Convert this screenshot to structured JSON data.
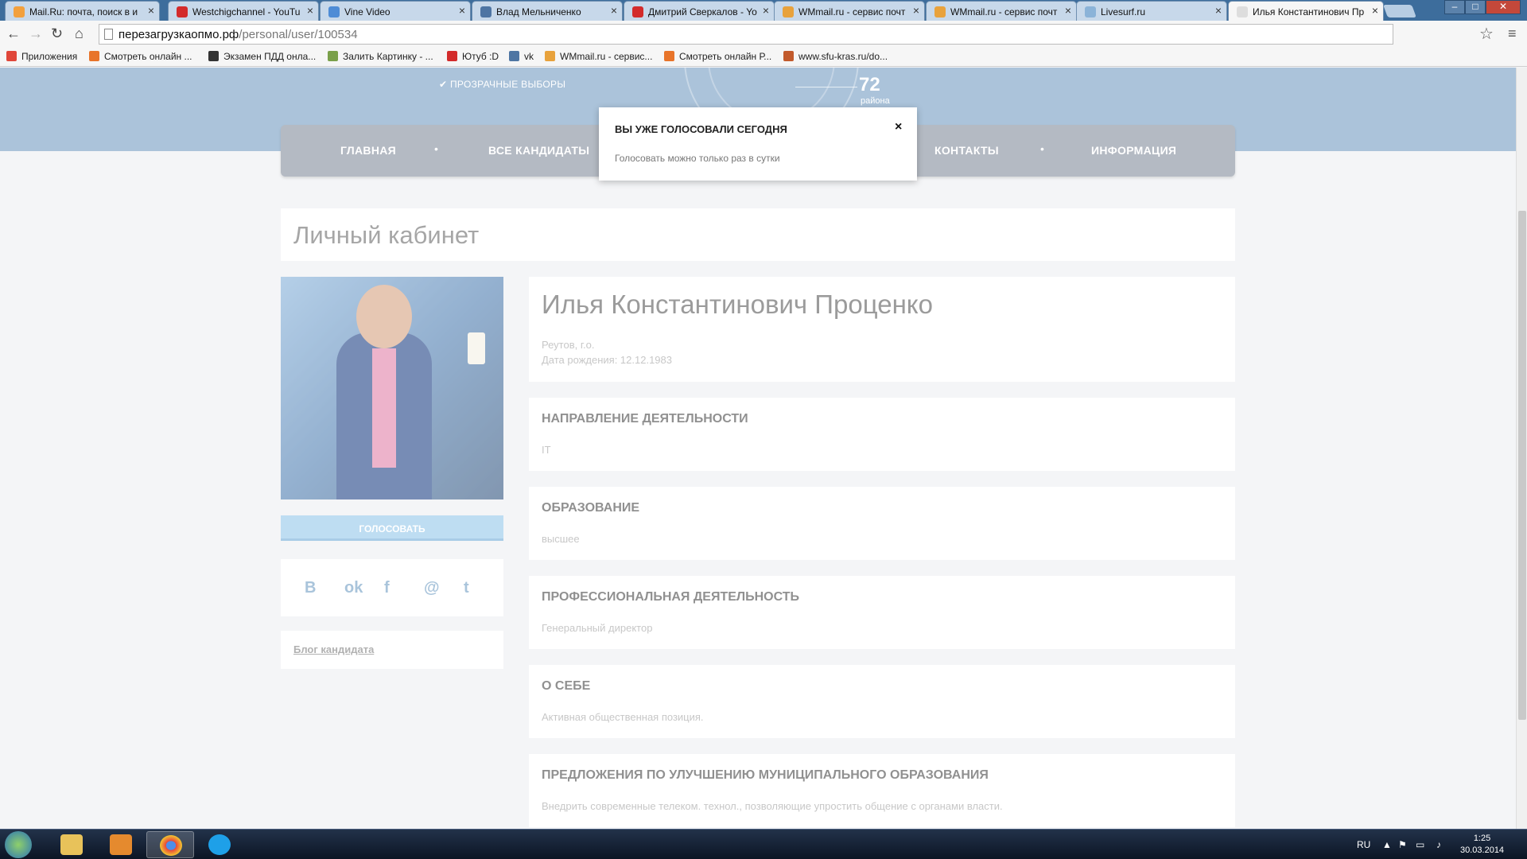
{
  "browser": {
    "tabs": [
      {
        "label": "Mail.Ru: почта, поиск в и",
        "icon": "mailru-icon",
        "color": "#f2a03d"
      },
      {
        "label": "Westchigchannel - YouTu",
        "icon": "youtube-icon",
        "color": "#d32b2b"
      },
      {
        "label": "Vine Video",
        "icon": "vine-icon",
        "color": "#4e8cd6"
      },
      {
        "label": "Влад Мельниченко",
        "icon": "vk-icon",
        "color": "#4e75a3"
      },
      {
        "label": "Дмитрий Сверкалов - Yo",
        "icon": "youtube-icon",
        "color": "#d32b2b"
      },
      {
        "label": "WMmail.ru - сервис почт",
        "icon": "wmmail-icon",
        "color": "#e8a23c"
      },
      {
        "label": "WMmail.ru - сервис почт",
        "icon": "wmmail-icon",
        "color": "#e8a23c"
      },
      {
        "label": "Livesurf.ru",
        "icon": "livesurf-icon",
        "color": "#8bb3d8"
      },
      {
        "label": "Илья Константинович Пр",
        "icon": "page-icon",
        "color": "#dddddd"
      }
    ],
    "url_host": "перезагрузкаопмо.рф",
    "url_path": "/personal/user/100534",
    "bookmarks": [
      {
        "label": "Приложения",
        "icon": "apps-icon",
        "color": "#e0473a"
      },
      {
        "label": "Смотреть онлайн ...",
        "icon": "f-icon",
        "color": "#e8742a"
      },
      {
        "label": "Экзамен ПДД онла...",
        "icon": "car-icon",
        "color": "#333333"
      },
      {
        "label": "Залить Картинку - ...",
        "icon": "image-icon",
        "color": "#7aa04a"
      },
      {
        "label": "Ютуб :D",
        "icon": "youtube-icon",
        "color": "#d32b2b"
      },
      {
        "label": "vk",
        "icon": "vk-icon",
        "color": "#4e75a3"
      },
      {
        "label": "WMmail.ru - сервис...",
        "icon": "wmmail-icon",
        "color": "#e8a23c"
      },
      {
        "label": "Смотреть онлайн Р...",
        "icon": "f-icon",
        "color": "#e8742a"
      },
      {
        "label": "www.sfu-kras.ru/do...",
        "icon": "sfu-icon",
        "color": "#c25a2c"
      }
    ]
  },
  "hero": {
    "fair": "ПРОЗРАЧНЫЕ ВЫБОРЫ",
    "count": "72",
    "count_label": "района"
  },
  "nav": [
    "ГЛАВНАЯ",
    "ВСЕ КАНДИДАТЫ",
    "КОНТАКТЫ",
    "ИНФОРМАЦИЯ"
  ],
  "popup": {
    "title": "ВЫ УЖЕ ГОЛОСОВАЛИ СЕГОДНЯ",
    "close": "×",
    "message": "Голосовать можно только раз в сутки"
  },
  "page_title": "Личный кабинет",
  "profile": {
    "name": "Илья Константинович Проценко",
    "city": "Реутов, г.о.",
    "birth": "Дата рождения: 12.12.1983"
  },
  "vote_button": "ГОЛОСОВАТЬ",
  "social": [
    {
      "glyph": "В",
      "icon": "vk-icon"
    },
    {
      "glyph": "ok",
      "icon": "odnoklassniki-icon"
    },
    {
      "glyph": "f",
      "icon": "facebook-icon"
    },
    {
      "glyph": "@",
      "icon": "mail-icon"
    },
    {
      "glyph": "t",
      "icon": "twitter-icon"
    }
  ],
  "blog_link": "Блог кандидата",
  "sections": [
    {
      "title": "НАПРАВЛЕНИЕ ДЕЯТЕЛЬНОСТИ",
      "value": "IT"
    },
    {
      "title": "ОБРАЗОВАНИЕ",
      "value": "высшее"
    },
    {
      "title": "ПРОФЕССИОНАЛЬНАЯ ДЕЯТЕЛЬНОСТЬ",
      "value": "Генеральный директор"
    },
    {
      "title": "О СЕБЕ",
      "value": "Активная общественная позиция."
    },
    {
      "title": "ПРЕДЛОЖЕНИЯ ПО УЛУЧШЕНИЮ МУНИЦИПАЛЬНОГО ОБРАЗОВАНИЯ",
      "value": "Внедрить современные телеком. технол., позволяющие упростить общение с органами власти."
    }
  ],
  "taskbar": {
    "lang": "RU",
    "time": "1:25",
    "date": "30.03.2014"
  }
}
